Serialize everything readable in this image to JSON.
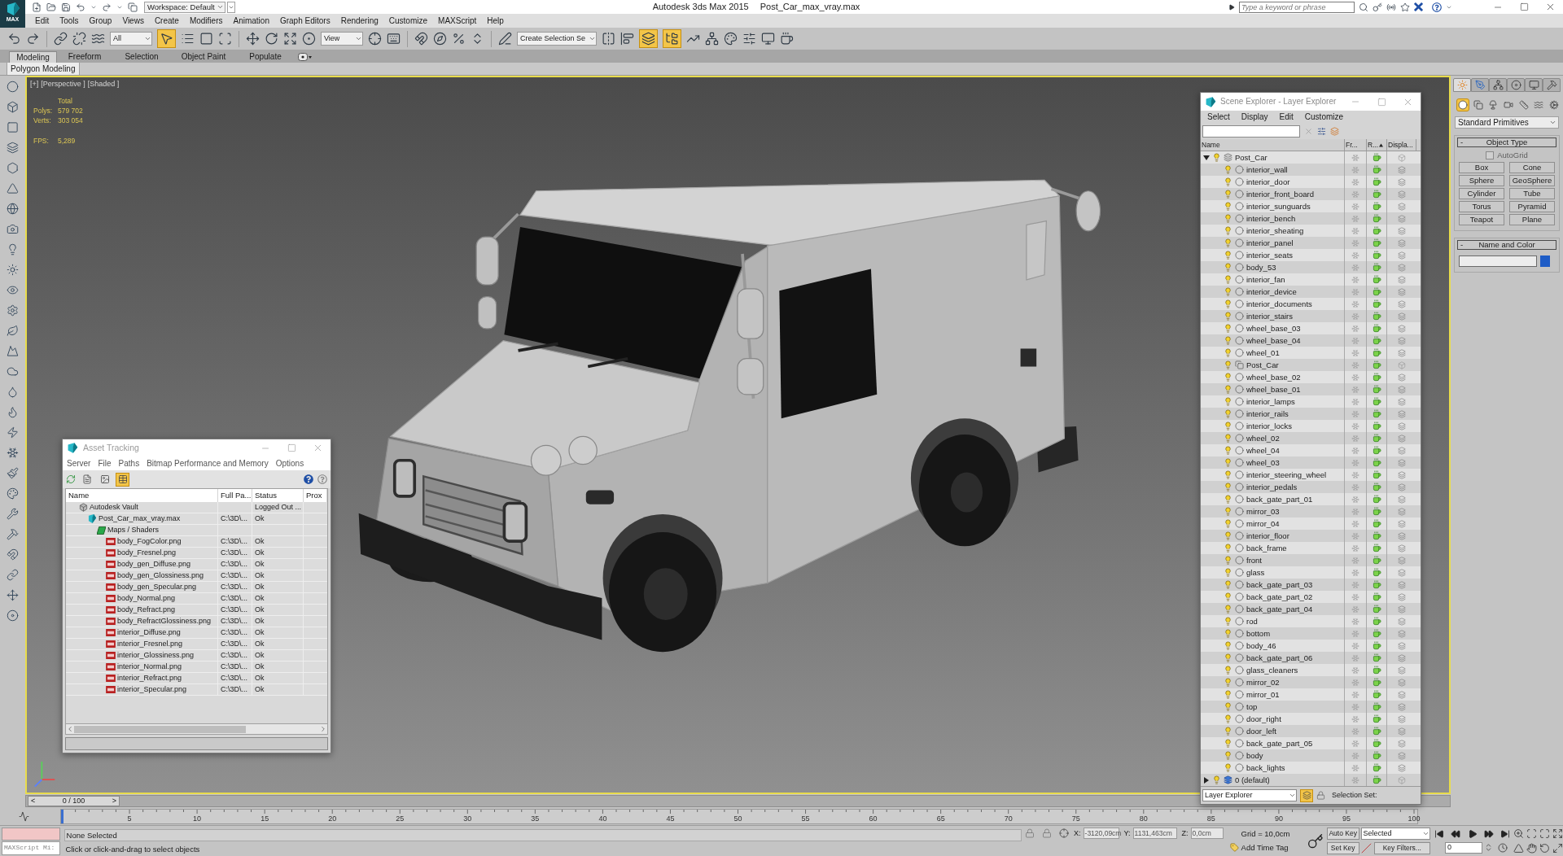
{
  "title_bar": {
    "logo_text": "MAX",
    "workspace": "Workspace: Default",
    "app_title": "Autodesk 3ds Max 2015",
    "file_name": "Post_Car_max_vray.max",
    "search": {
      "placeholder": "Type a keyword or phrase"
    }
  },
  "menu": [
    "Edit",
    "Tools",
    "Group",
    "Views",
    "Create",
    "Modifiers",
    "Animation",
    "Graph Editors",
    "Rendering",
    "Customize",
    "MAXScript",
    "Help"
  ],
  "toolbar": {
    "selection_filter": "All",
    "reference_coordinate_system": "View",
    "named_selection_set": "Create Selection Se",
    "select_object": {
      "active": true
    },
    "layer_explorer": {
      "active": true
    },
    "scene_explorer": {
      "active": true
    }
  },
  "ribbon": {
    "tabs": [
      {
        "label": "Modeling",
        "selected": true
      },
      {
        "label": "Freeform",
        "selected": false
      },
      {
        "label": "Selection",
        "selected": false
      },
      {
        "label": "Object Paint",
        "selected": false
      },
      {
        "label": "Populate",
        "selected": false
      }
    ],
    "panel": "Polygon Modeling"
  },
  "viewport": {
    "active": true,
    "labels": [
      "[+]",
      "[Perspective ]",
      "[Shaded ]"
    ],
    "stats": {
      "header": "Total",
      "rows": [
        {
          "label": "Polys:",
          "value": "579 702"
        },
        {
          "label": "Verts:",
          "value": "303 054"
        }
      ],
      "fps": {
        "label": "FPS:",
        "value": "5,289"
      }
    }
  },
  "asset_tracking": {
    "title": "Asset Tracking",
    "menu": [
      "Server",
      "File",
      "Paths",
      "Bitmap Performance and Memory",
      "Options"
    ],
    "view_modes": [
      {
        "selected": false
      },
      {
        "selected": false
      },
      {
        "selected": true
      }
    ],
    "columns": [
      "Name",
      "Full Pa...",
      "Status",
      "Prox"
    ],
    "tree": [
      {
        "kind": "vault",
        "name": "Autodesk Vault",
        "status": "Logged Out ...",
        "children": [
          {
            "kind": "scene",
            "name": "Post_Car_max_vray.max",
            "full_path": "C:\\3D\\...",
            "status": "Ok",
            "children": [
              {
                "kind": "folder",
                "name": "Maps / Shaders",
                "children": [
                  {
                    "kind": "image",
                    "name": "body_FogColor.png",
                    "full_path": "C:\\3D\\...",
                    "status": "Ok"
                  },
                  {
                    "kind": "image",
                    "name": "body_Fresnel.png",
                    "full_path": "C:\\3D\\...",
                    "status": "Ok"
                  },
                  {
                    "kind": "image",
                    "name": "body_gen_Diffuse.png",
                    "full_path": "C:\\3D\\...",
                    "status": "Ok"
                  },
                  {
                    "kind": "image",
                    "name": "body_gen_Glossiness.png",
                    "full_path": "C:\\3D\\...",
                    "status": "Ok"
                  },
                  {
                    "kind": "image",
                    "name": "body_gen_Specular.png",
                    "full_path": "C:\\3D\\...",
                    "status": "Ok"
                  },
                  {
                    "kind": "image",
                    "name": "body_Normal.png",
                    "full_path": "C:\\3D\\...",
                    "status": "Ok"
                  },
                  {
                    "kind": "image",
                    "name": "body_Refract.png",
                    "full_path": "C:\\3D\\...",
                    "status": "Ok"
                  },
                  {
                    "kind": "image",
                    "name": "body_RefractGlossiness.png",
                    "full_path": "C:\\3D\\...",
                    "status": "Ok"
                  },
                  {
                    "kind": "image",
                    "name": "interior_Diffuse.png",
                    "full_path": "C:\\3D\\...",
                    "status": "Ok"
                  },
                  {
                    "kind": "image",
                    "name": "interior_Fresnel.png",
                    "full_path": "C:\\3D\\...",
                    "status": "Ok"
                  },
                  {
                    "kind": "image",
                    "name": "interior_Glossiness.png",
                    "full_path": "C:\\3D\\...",
                    "status": "Ok"
                  },
                  {
                    "kind": "image",
                    "name": "interior_Normal.png",
                    "full_path": "C:\\3D\\...",
                    "status": "Ok"
                  },
                  {
                    "kind": "image",
                    "name": "interior_Refract.png",
                    "full_path": "C:\\3D\\...",
                    "status": "Ok"
                  },
                  {
                    "kind": "image",
                    "name": "interior_Specular.png",
                    "full_path": "C:\\3D\\...",
                    "status": "Ok"
                  }
                ]
              }
            ]
          }
        ]
      }
    ]
  },
  "scene_explorer": {
    "title": "Scene Explorer - Layer Explorer",
    "menu": [
      "Select",
      "Display",
      "Edit",
      "Customize"
    ],
    "columns": [
      {
        "label": "Name",
        "sorted": false
      },
      {
        "label": "Fr...",
        "sorted": false
      },
      {
        "label": "R...",
        "sorted": true
      },
      {
        "label": "Displa...",
        "sorted": false
      }
    ],
    "layers": [
      {
        "name": "Post_Car",
        "expanded": true,
        "current": false,
        "children": [
          {
            "kind": "object",
            "name": "interior_wall"
          },
          {
            "kind": "object",
            "name": "interior_door"
          },
          {
            "kind": "object",
            "name": "interior_front_board"
          },
          {
            "kind": "object",
            "name": "interior_sunguards"
          },
          {
            "kind": "object",
            "name": "interior_bench"
          },
          {
            "kind": "object",
            "name": "interior_sheating"
          },
          {
            "kind": "object",
            "name": "interior_panel"
          },
          {
            "kind": "object",
            "name": "interior_seats"
          },
          {
            "kind": "object",
            "name": "body_53"
          },
          {
            "kind": "object",
            "name": "interior_fan"
          },
          {
            "kind": "object",
            "name": "interior_device"
          },
          {
            "kind": "object",
            "name": "interior_documents"
          },
          {
            "kind": "object",
            "name": "interior_stairs"
          },
          {
            "kind": "object",
            "name": "wheel_base_03"
          },
          {
            "kind": "object",
            "name": "wheel_base_04"
          },
          {
            "kind": "object",
            "name": "wheel_01"
          },
          {
            "kind": "group",
            "name": "Post_Car"
          },
          {
            "kind": "object",
            "name": "wheel_base_02"
          },
          {
            "kind": "object",
            "name": "wheel_base_01"
          },
          {
            "kind": "object",
            "name": "interior_lamps"
          },
          {
            "kind": "object",
            "name": "interior_rails"
          },
          {
            "kind": "object",
            "name": "interior_locks"
          },
          {
            "kind": "object",
            "name": "wheel_02"
          },
          {
            "kind": "object",
            "name": "wheel_04"
          },
          {
            "kind": "object",
            "name": "wheel_03"
          },
          {
            "kind": "object",
            "name": "interior_steering_wheel"
          },
          {
            "kind": "object",
            "name": "interior_pedals"
          },
          {
            "kind": "object",
            "name": "back_gate_part_01"
          },
          {
            "kind": "object",
            "name": "mirror_03"
          },
          {
            "kind": "object",
            "name": "mirror_04"
          },
          {
            "kind": "object",
            "name": "interior_floor"
          },
          {
            "kind": "object",
            "name": "back_frame"
          },
          {
            "kind": "object",
            "name": "front"
          },
          {
            "kind": "object",
            "name": "glass"
          },
          {
            "kind": "object",
            "name": "back_gate_part_03"
          },
          {
            "kind": "object",
            "name": "back_gate_part_02"
          },
          {
            "kind": "object",
            "name": "back_gate_part_04"
          },
          {
            "kind": "object",
            "name": "rod"
          },
          {
            "kind": "object",
            "name": "bottom"
          },
          {
            "kind": "object",
            "name": "body_46"
          },
          {
            "kind": "object",
            "name": "back_gate_part_06"
          },
          {
            "kind": "object",
            "name": "glass_cleaners"
          },
          {
            "kind": "object",
            "name": "mirror_02"
          },
          {
            "kind": "object",
            "name": "mirror_01"
          },
          {
            "kind": "object",
            "name": "top"
          },
          {
            "kind": "object",
            "name": "door_right"
          },
          {
            "kind": "object",
            "name": "door_left"
          },
          {
            "kind": "object",
            "name": "back_gate_part_05"
          },
          {
            "kind": "object",
            "name": "body"
          },
          {
            "kind": "object",
            "name": "back_lights"
          }
        ]
      },
      {
        "name": "0 (default)",
        "expanded": false,
        "current": true
      }
    ],
    "footer": {
      "mode": "Layer Explorer",
      "layer_toggle_active": true,
      "selection_set_label": "Selection Set:"
    }
  },
  "command_panel": {
    "tabs": [
      {
        "selected": true
      },
      {
        "selected": false
      },
      {
        "selected": false
      },
      {
        "selected": false
      },
      {
        "selected": false
      },
      {
        "selected": false
      }
    ],
    "categories": [
      {
        "selected": true
      },
      {
        "selected": false
      },
      {
        "selected": false
      },
      {
        "selected": false
      },
      {
        "selected": false
      },
      {
        "selected": false
      },
      {
        "selected": false
      }
    ],
    "object_category": "Standard Primitives",
    "rollouts": [
      {
        "kind": "object_type",
        "toggle": "-",
        "title": "Object Type",
        "autogrid": {
          "label": "AutoGrid",
          "checked": false,
          "disabled": true
        },
        "buttons": [
          "Box",
          "Cone",
          "Sphere",
          "GeoSphere",
          "Cylinder",
          "Tube",
          "Torus",
          "Pyramid",
          "Teapot",
          "Plane"
        ]
      },
      {
        "kind": "name_color",
        "toggle": "-",
        "title": "Name and Color",
        "color": "#1e5cc6"
      }
    ]
  },
  "time_slider": {
    "level": 0,
    "frame": "0 / 100",
    "previous": "<",
    "next": ">"
  },
  "track_bar": {
    "labels": [
      "5",
      "10",
      "15",
      "20",
      "25",
      "30",
      "35",
      "40",
      "45",
      "50",
      "55",
      "60",
      "65",
      "70",
      "75",
      "80",
      "85",
      "90",
      "95",
      "100"
    ]
  },
  "status_bar": {
    "listener": "MAXScript Mi:",
    "selection": "None Selected",
    "prompt": "Click or click-and-drag to select objects",
    "coordinates": [
      {
        "label": "X:",
        "value": "-3120,09cm"
      },
      {
        "label": "Y:",
        "value": "1131,463cm"
      },
      {
        "label": "Z:",
        "value": "0,0cm"
      }
    ],
    "grid": "Grid = 10,0cm",
    "time_tag": "Add Time Tag"
  },
  "animation_controls": {
    "auto_key": "Auto Key",
    "set_key": "Set Key",
    "key_mode": "Selected",
    "key_filters": "Key Filters...",
    "current_frame": "0"
  }
}
